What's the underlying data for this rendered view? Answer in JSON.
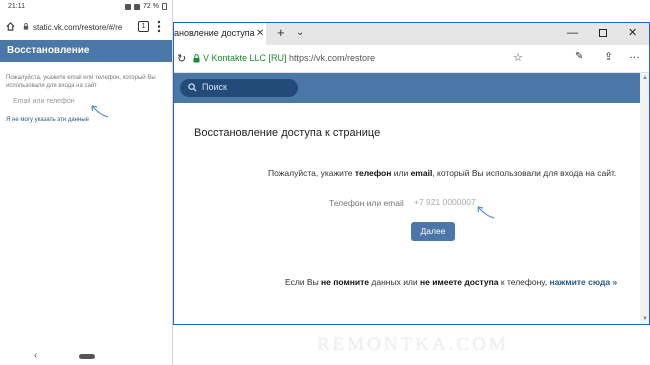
{
  "phone": {
    "status": {
      "time": "21:11",
      "battery": "72 %"
    },
    "url": "static.vk.com/restore/#/re",
    "tabs_count": "1",
    "header_title": "Восстановление",
    "help_text": "Пожалуйста, укажите email или телефон, который Вы использовали для входа на сайт",
    "input_placeholder": "Email или телефон",
    "cant_provide_link": "Я не могу указать эти данные"
  },
  "browser": {
    "tab_title": "ановление доступа",
    "cert_name": "V Kontakte LLC [RU]",
    "url": "https://vk.com/restore",
    "search_placeholder": "Поиск",
    "page_title": "Восстановление доступа к странице",
    "instruction": {
      "p1": "Пожалуйста, укажите ",
      "b1": "телефон",
      "p2": " или ",
      "b2": "email",
      "p3": ", который Вы использовали для входа на сайт."
    },
    "field_label": "Телефон или email",
    "field_placeholder": "+7 921 0000007",
    "next_button": "Далее",
    "footer": {
      "p1": "Если Вы ",
      "b1": "не помните",
      "p2": " данных или ",
      "b2": "не имеете доступа",
      "p3": " к телефону, ",
      "link": "нажмите сюда »"
    }
  },
  "watermark": "REMONTKA.COM",
  "colors": {
    "vk_blue": "#4a76a8",
    "link": "#2a5885",
    "cert_green": "#1a8c2e"
  },
  "icons": [
    "home-icon",
    "lock-icon",
    "tabs-icon",
    "more-icon",
    "search-icon",
    "star-icon",
    "pen-icon",
    "share-icon",
    "close-icon",
    "arrow-icon"
  ]
}
